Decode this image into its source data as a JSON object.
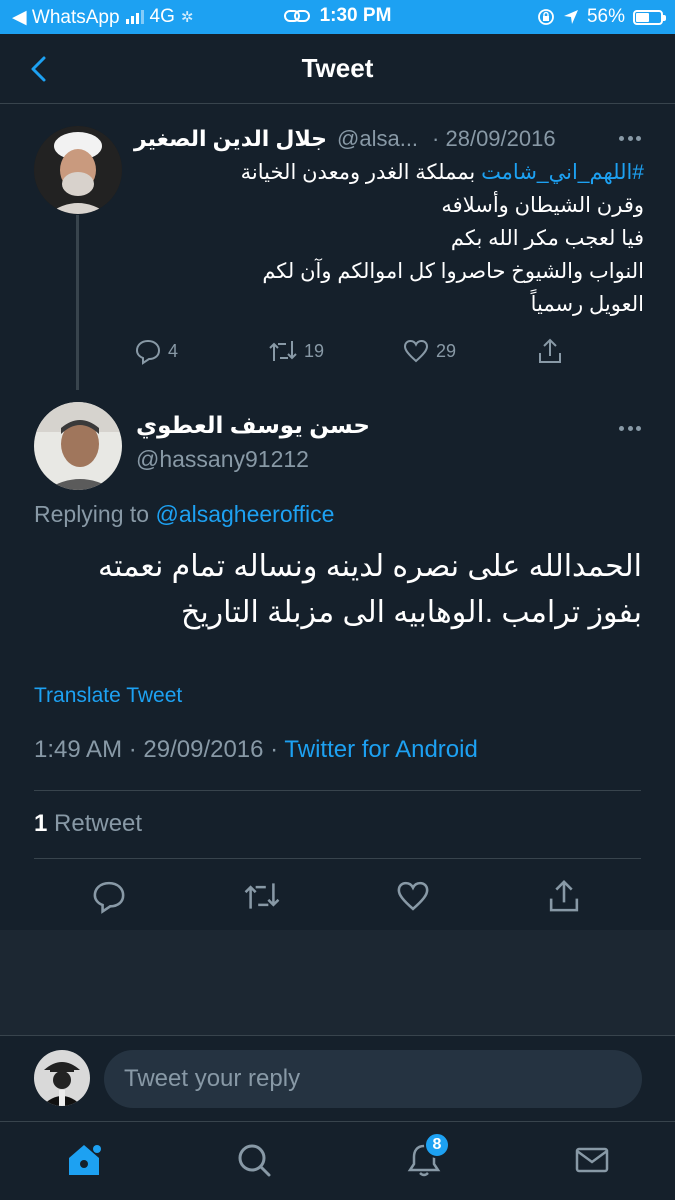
{
  "colors": {
    "accent": "#1da1f2",
    "background": "#15202b",
    "muted": "#8899a6",
    "divider": "#38444d"
  },
  "status_bar": {
    "carrier": "◀ WhatsApp",
    "network": "4G",
    "time": "1:30 PM",
    "battery": "56%",
    "battery_level": 0.56
  },
  "nav": {
    "title": "Tweet",
    "back_icon": "chevron-left-icon"
  },
  "parent_tweet": {
    "name": "جلال الدين الصغير",
    "handle": "@alsa...",
    "date": "· 28/09/2016",
    "hashtag": "#اللهم_اني_شامت",
    "text_line1_rest": " بمملكة الغدر ومعدن الخيانة",
    "text_line2": "وقرن الشيطان وأسلافه",
    "text_line3": "فيا لعجب مكر الله بكم",
    "text_line4": "النواب والشيوخ حاصروا كل اموالكم وآن لكم",
    "text_line5": "العويل رسمياً",
    "replies": "4",
    "retweets": "19",
    "likes": "29"
  },
  "main_tweet": {
    "name": "حسن  يوسف العطوي",
    "handle": "@hassany91212",
    "replying_prefix": "Replying to ",
    "replying_mention": "@alsagheeroffice",
    "text_line1": "الحمدالله على نصره لدينه ونساله تمام نعمته",
    "text_line2": "بفوز ترامب .الوهابيه الى مزبلة التاريخ",
    "translate": "Translate Tweet",
    "time": "1:49 AM · 29/09/2016 · ",
    "source": "Twitter for Android",
    "retweet_count": "1",
    "retweet_label": " Retweet"
  },
  "reply": {
    "placeholder": "Tweet your reply"
  },
  "tab_bar": {
    "notifications_badge": "8",
    "items": [
      "home-icon",
      "search-icon",
      "notifications-icon",
      "messages-icon"
    ]
  }
}
